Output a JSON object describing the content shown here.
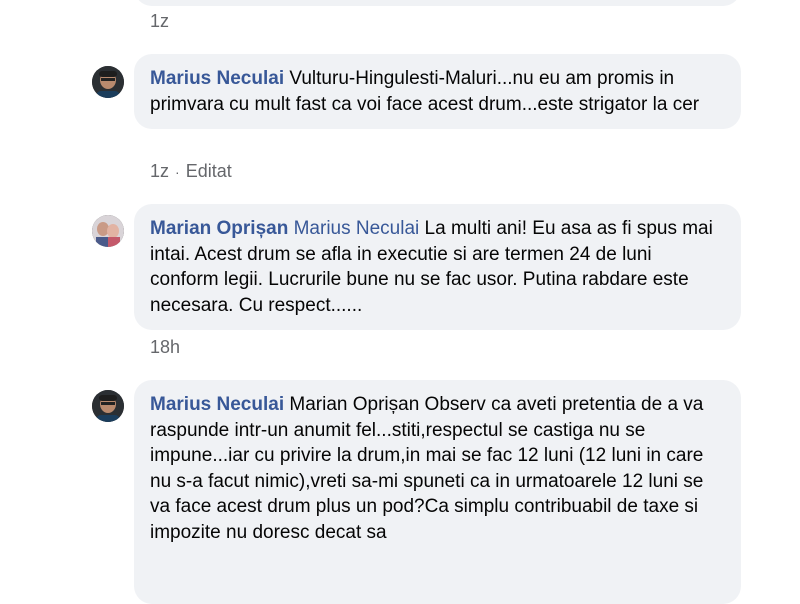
{
  "comments": [
    {
      "time": "1z"
    },
    {
      "author": "Marius Neculai",
      "text": "Vulturu-Hingulesti-Maluri...nu eu am promis in primvara cu mult fast ca voi face acest drum...este strigator la cer",
      "time": "1z",
      "edited": "Editat"
    },
    {
      "author": "Marian Oprișan",
      "mention": "Marius Neculai",
      "text": "La multi ani! Eu asa as fi spus mai intai. Acest drum se afla in executie si are termen 24 de luni conform legii. Lucrurile bune nu se fac usor. Putina rabdare este necesara. Cu respect......",
      "time": "18h"
    },
    {
      "author": "Marius Neculai",
      "text": "Marian Oprișan Observ ca aveti pretentia de a va raspunde intr-un anumit fel...stiti,respectul se castiga nu se impune...iar cu privire la drum,in mai se fac 12 luni (12 luni in care nu s-a facut nimic),vreti sa-mi spuneti ca in urmatoarele 12 luni se va face acest drum plus un pod?Ca simplu contribuabil de taxe si impozite nu doresc decat sa"
    }
  ]
}
